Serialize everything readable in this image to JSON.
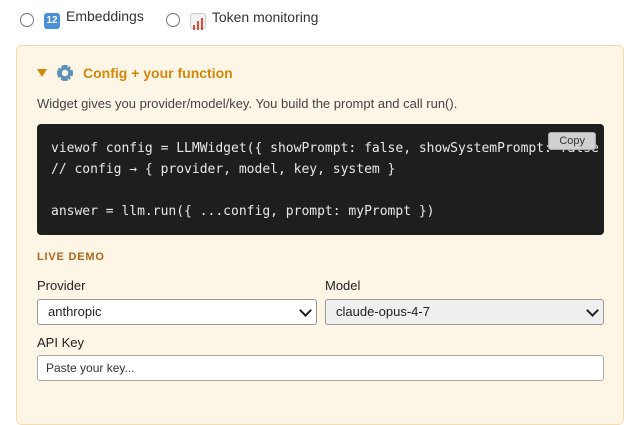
{
  "radio_options": [
    {
      "label": "Embeddings",
      "icon": "numbers-icon"
    },
    {
      "label": "Token monitoring",
      "icon": "bar-chart-icon"
    }
  ],
  "section": {
    "title": "Config + your function",
    "description": "Widget gives you provider/model/key. You build the prompt and call run().",
    "code_lines": [
      "viewof config = LLMWidget({ showPrompt: false, showSystemPrompt: false",
      "// config → { provider, model, key, system }",
      "",
      "answer = llm.run({ ...config, prompt: myPrompt })"
    ],
    "copy_label": "Copy"
  },
  "demo": {
    "heading": "LIVE DEMO",
    "provider_label": "Provider",
    "provider_value": "anthropic",
    "model_label": "Model",
    "model_value": "claude-opus-4-7",
    "api_key_label": "API Key",
    "api_key_placeholder": "Paste your key..."
  },
  "colors": {
    "accent": "#d4860b",
    "panel_bg": "#fdf6e7",
    "code_bg": "#1e1e1e"
  }
}
